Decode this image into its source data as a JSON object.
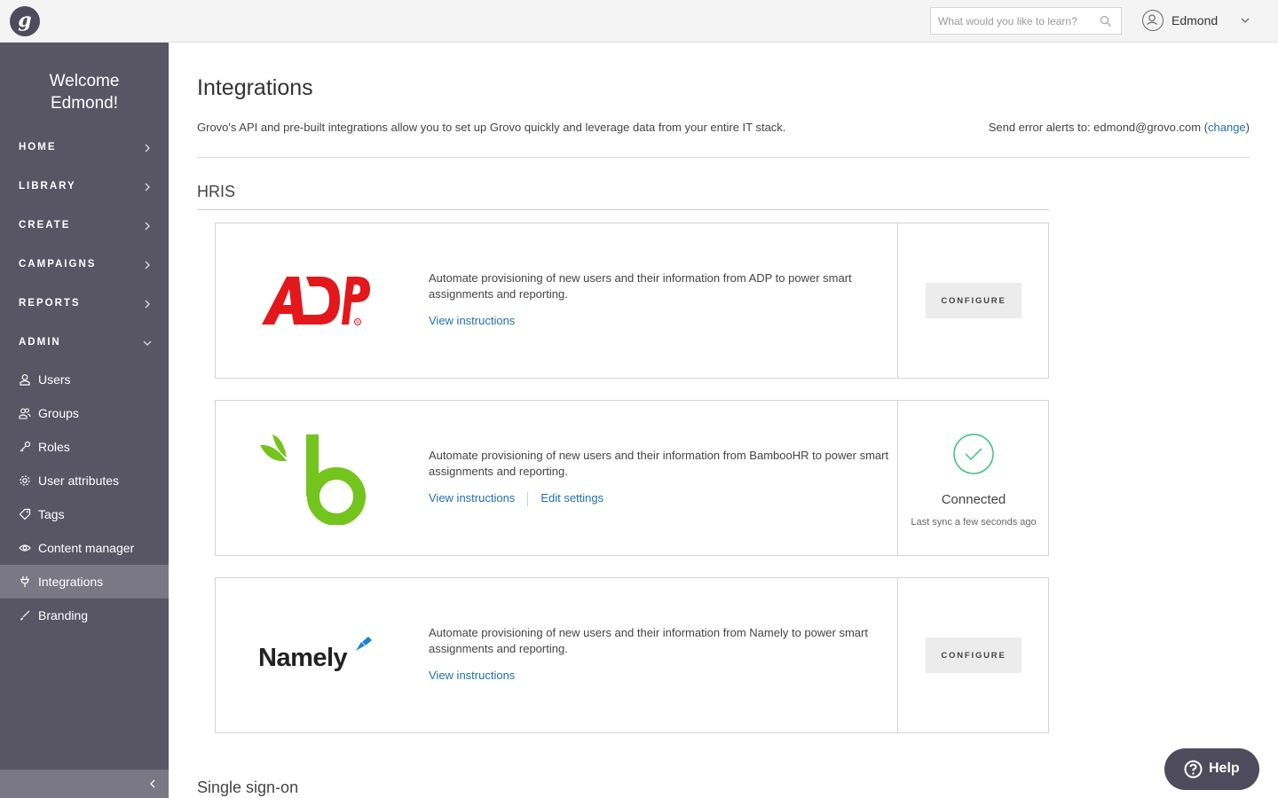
{
  "app": {
    "logo_letter": "g"
  },
  "search": {
    "placeholder": "What would you like to learn?"
  },
  "user": {
    "name": "Edmond"
  },
  "sidebar": {
    "welcome_line1": "Welcome",
    "welcome_line2": "Edmond!",
    "nav": [
      {
        "label": "HOME"
      },
      {
        "label": "LIBRARY"
      },
      {
        "label": "CREATE"
      },
      {
        "label": "CAMPAIGNS"
      },
      {
        "label": "REPORTS"
      },
      {
        "label": "ADMIN"
      }
    ],
    "admin_items": [
      {
        "label": "Users",
        "icon": "user-icon"
      },
      {
        "label": "Groups",
        "icon": "groups-icon"
      },
      {
        "label": "Roles",
        "icon": "key-icon"
      },
      {
        "label": "User attributes",
        "icon": "gear-icon"
      },
      {
        "label": "Tags",
        "icon": "tag-icon"
      },
      {
        "label": "Content manager",
        "icon": "eye-icon"
      },
      {
        "label": "Integrations",
        "icon": "plug-icon",
        "active": true
      },
      {
        "label": "Branding",
        "icon": "brush-icon"
      }
    ]
  },
  "main": {
    "title": "Integrations",
    "description": "Grovo's API and pre-built integrations allow you to set up Grovo quickly and leverage data from your entire IT stack.",
    "alerts_prefix": "Send error alerts to: edmond@grovo.com (",
    "alerts_link": "change",
    "alerts_suffix": ")",
    "section_hris": "HRIS",
    "section_sso": "Single sign-on",
    "integrations": [
      {
        "name": "ADP",
        "description": "Automate provisioning of new users and their information from ADP to power smart assignments and reporting.",
        "view_link": "View instructions",
        "button": "CONFIGURE"
      },
      {
        "name": "BambooHR",
        "description": "Automate provisioning of new users and their information from BambooHR to power smart assignments and reporting.",
        "view_link": "View instructions",
        "edit_link": "Edit settings",
        "status": "Connected",
        "sync": "Last sync a few seconds ago"
      },
      {
        "name": "Namely",
        "logo_text": "Namely",
        "description": "Automate provisioning of new users and their information from Namely to power smart assignments and reporting.",
        "view_link": "View instructions",
        "button": "CONFIGURE"
      }
    ]
  },
  "help": {
    "label": "Help"
  },
  "colors": {
    "sidebar": "#585665",
    "link": "#1f6fb2",
    "adp_red": "#e2181c",
    "bamboo_green": "#73c41d",
    "connected": "#3cc47c",
    "namely_blue": "#1a82d6"
  }
}
